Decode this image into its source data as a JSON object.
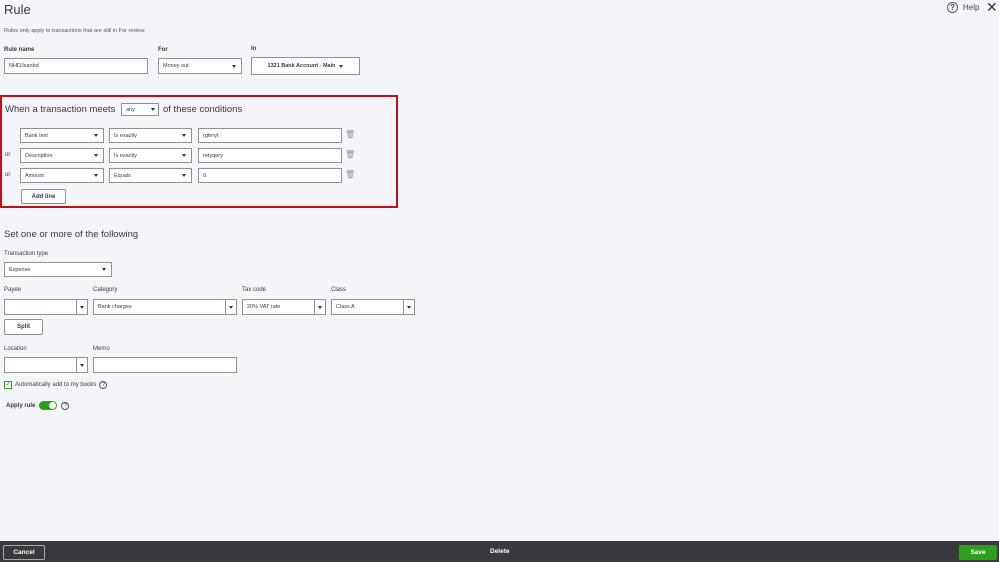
{
  "header": {
    "title": "Rule",
    "subtitle": "Rules only apply to transactions that are still in For review.",
    "help_label": "Help",
    "help_icon": "question-circle-icon",
    "close_icon": "close-icon"
  },
  "top_fields": {
    "rule_name_label": "Rule name",
    "rule_name_value": "NHDJsanbd",
    "for_label": "For",
    "for_value": "Money out",
    "in_label": "In",
    "in_value": "1321 Bank Account - Main"
  },
  "conditions": {
    "lead_text": "When a transaction meets",
    "match_value": "any",
    "tail_text": "of these conditions",
    "rows": [
      {
        "prefix": "",
        "field": "Bank text",
        "operator": "Is exactly",
        "value": "rgteryt"
      },
      {
        "prefix": "or",
        "field": "Description",
        "operator": "Is exactly",
        "value": "retyqery"
      },
      {
        "prefix": "or",
        "field": "Amount",
        "operator": "Equals",
        "value": "0"
      }
    ],
    "add_line_label": "Add line",
    "trash_icon": "trash-icon"
  },
  "actions": {
    "heading": "Set one or more of the following",
    "transaction_type_label": "Transaction type",
    "transaction_type_value": "Expense",
    "payee_label": "Payee",
    "payee_value": "",
    "category_label": "Category",
    "category_value": "Bank charges",
    "tax_code_label": "Tax code",
    "tax_code_value": "20% VAT rate",
    "class_label": "Class",
    "class_value": "Class A",
    "split_label": "Split",
    "location_label": "Location",
    "location_value": "",
    "memo_label": "Memo",
    "memo_value": "",
    "auto_add_label": "Automatically add to my books",
    "auto_add_checked": true,
    "apply_rule_label": "Apply rule",
    "apply_rule_on": true
  },
  "footer": {
    "cancel_label": "Cancel",
    "delete_label": "Delete",
    "save_label": "Save"
  },
  "colors": {
    "highlight_border": "#c0111f",
    "accent_green": "#2ca01c",
    "footer_bg": "#393a3d",
    "page_bg": "#f4f5f8"
  }
}
